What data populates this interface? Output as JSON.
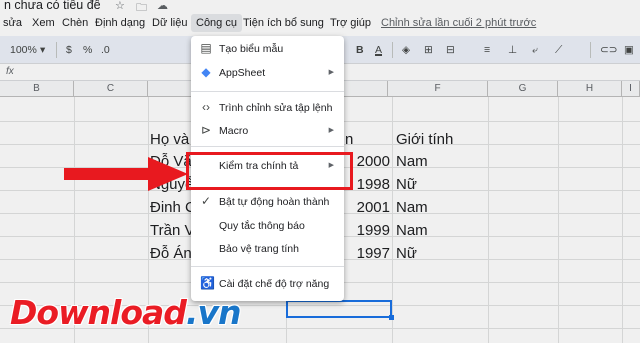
{
  "title_bar": {
    "doc_title": "n chưa có tiêu đề",
    "star_icon": "☆",
    "folder_icon": "🗀",
    "cloud_icon": "☁"
  },
  "menubar": {
    "items": [
      "sửa",
      "Xem",
      "Chèn",
      "Định dạng",
      "Dữ liệu",
      "Công cụ",
      "Tiện ích bổ sung",
      "Trợ giúp"
    ],
    "last_edit": "Chỉnh sửa lần cuối 2 phút trước"
  },
  "toolbar": {
    "zoom": "100%",
    "currency": "$",
    "percent": "%",
    "decimal": ".0",
    "bold": "B",
    "text_color": "A"
  },
  "formula_bar": {
    "fx": "fx"
  },
  "columns": [
    "B",
    "C",
    "",
    "",
    "",
    "F",
    "G",
    "H",
    "I"
  ],
  "cells": {
    "header_name": "Họ và",
    "header_year_partial": "n",
    "header_gender": "Giới tính",
    "rows": [
      {
        "name": "Đỗ Vă",
        "year": "2000",
        "gender": "Nam"
      },
      {
        "name": "Nguyễ",
        "year": "1998",
        "gender": "Nữ"
      },
      {
        "name": "Đinh C",
        "year": "2001",
        "gender": "Nam"
      },
      {
        "name": "Trần V",
        "year": "1999",
        "gender": "Nam"
      },
      {
        "name": "Đỗ Án",
        "year": "1997",
        "gender": "Nữ"
      }
    ]
  },
  "tools_menu": {
    "items": [
      {
        "label": "Tạo biểu mẫu",
        "icon": "form-icon",
        "submenu": false
      },
      {
        "label": "AppSheet",
        "icon": "appsheet-icon",
        "submenu": true
      },
      {
        "label": "Trình chỉnh sửa tập lệnh",
        "icon": "code-icon",
        "submenu": false
      },
      {
        "label": "Macro",
        "icon": "play-circle-icon",
        "submenu": true
      },
      {
        "label": "Kiểm tra chính tả",
        "icon": "",
        "submenu": true
      },
      {
        "label": "Bật tự động hoàn thành",
        "icon": "check-icon",
        "submenu": false
      },
      {
        "label": "Quy tắc thông báo",
        "icon": "",
        "submenu": false
      },
      {
        "label": "Bảo vệ trang tính",
        "icon": "",
        "submenu": false
      },
      {
        "label": "Cài đặt chế độ trợ năng",
        "icon": "accessibility-icon",
        "submenu": false
      }
    ]
  },
  "watermark": {
    "main": "Download",
    "suffix": ".vn"
  },
  "colors": {
    "highlight": "#e8191f",
    "accent": "#1a73e8",
    "watermark_red": "#ea1c24",
    "watermark_blue": "#1976c9"
  }
}
